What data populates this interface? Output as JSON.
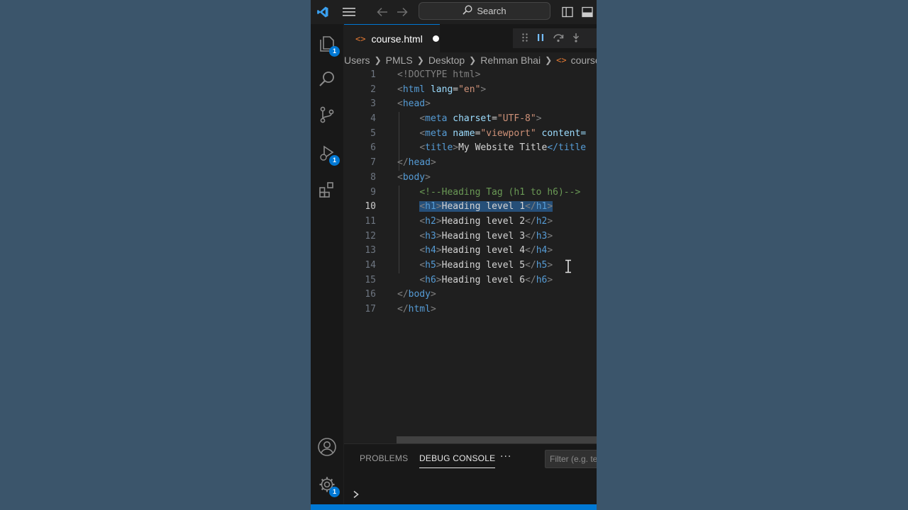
{
  "titlebar": {
    "search_label": "Search"
  },
  "activitybar": {
    "explorer_badge": "1",
    "debug_badge": "1",
    "settings_badge": "1"
  },
  "editor": {
    "tab_label": "course.html",
    "breadcrumb": [
      "Users",
      "PMLS",
      "Desktop",
      "Rehman Bhai",
      "course.htm"
    ],
    "active_line": 10,
    "lines": [
      {
        "n": "1"
      },
      {
        "n": "2"
      },
      {
        "n": "3"
      },
      {
        "n": "4"
      },
      {
        "n": "5"
      },
      {
        "n": "6"
      },
      {
        "n": "7"
      },
      {
        "n": "8"
      },
      {
        "n": "9"
      },
      {
        "n": "10"
      },
      {
        "n": "11"
      },
      {
        "n": "12"
      },
      {
        "n": "13"
      },
      {
        "n": "14"
      },
      {
        "n": "15"
      },
      {
        "n": "16"
      },
      {
        "n": "17"
      }
    ],
    "code": {
      "l1": "<!DOCTYPE html>",
      "l2_tag": "html",
      "l2_attr": "lang",
      "l2_val": "\"en\"",
      "l3": "head",
      "l4_tag": "meta",
      "l4_attr": "charset",
      "l4_val": "\"UTF-8\"",
      "l5_tag": "meta",
      "l5_attr1": "name",
      "l5_val1": "\"viewport\"",
      "l5_attr2": "content=",
      "l6_tag": "title",
      "l6_text": "My Website Title",
      "l6_close": "</title",
      "l7": "head",
      "l8": "body",
      "l9": "<!--Heading Tag (h1 to h6)-->",
      "h1": "Heading level 1",
      "h2": "Heading level 2",
      "h3": "Heading level 3",
      "h4": "Heading level 4",
      "h5": "Heading level 5",
      "h6": "Heading level 6",
      "l16": "body",
      "l17": "html"
    }
  },
  "panel": {
    "tab_problems": "PROBLEMS",
    "tab_debug_console": "DEBUG CONSOLE",
    "more": "···",
    "filter_placeholder": "Filter (e.g. text"
  },
  "colors": {
    "accent": "#0078d4",
    "tag": "#569cd6",
    "attribute": "#9cdcfe",
    "string": "#ce9178",
    "comment": "#6a9955",
    "selection": "#264f78"
  }
}
